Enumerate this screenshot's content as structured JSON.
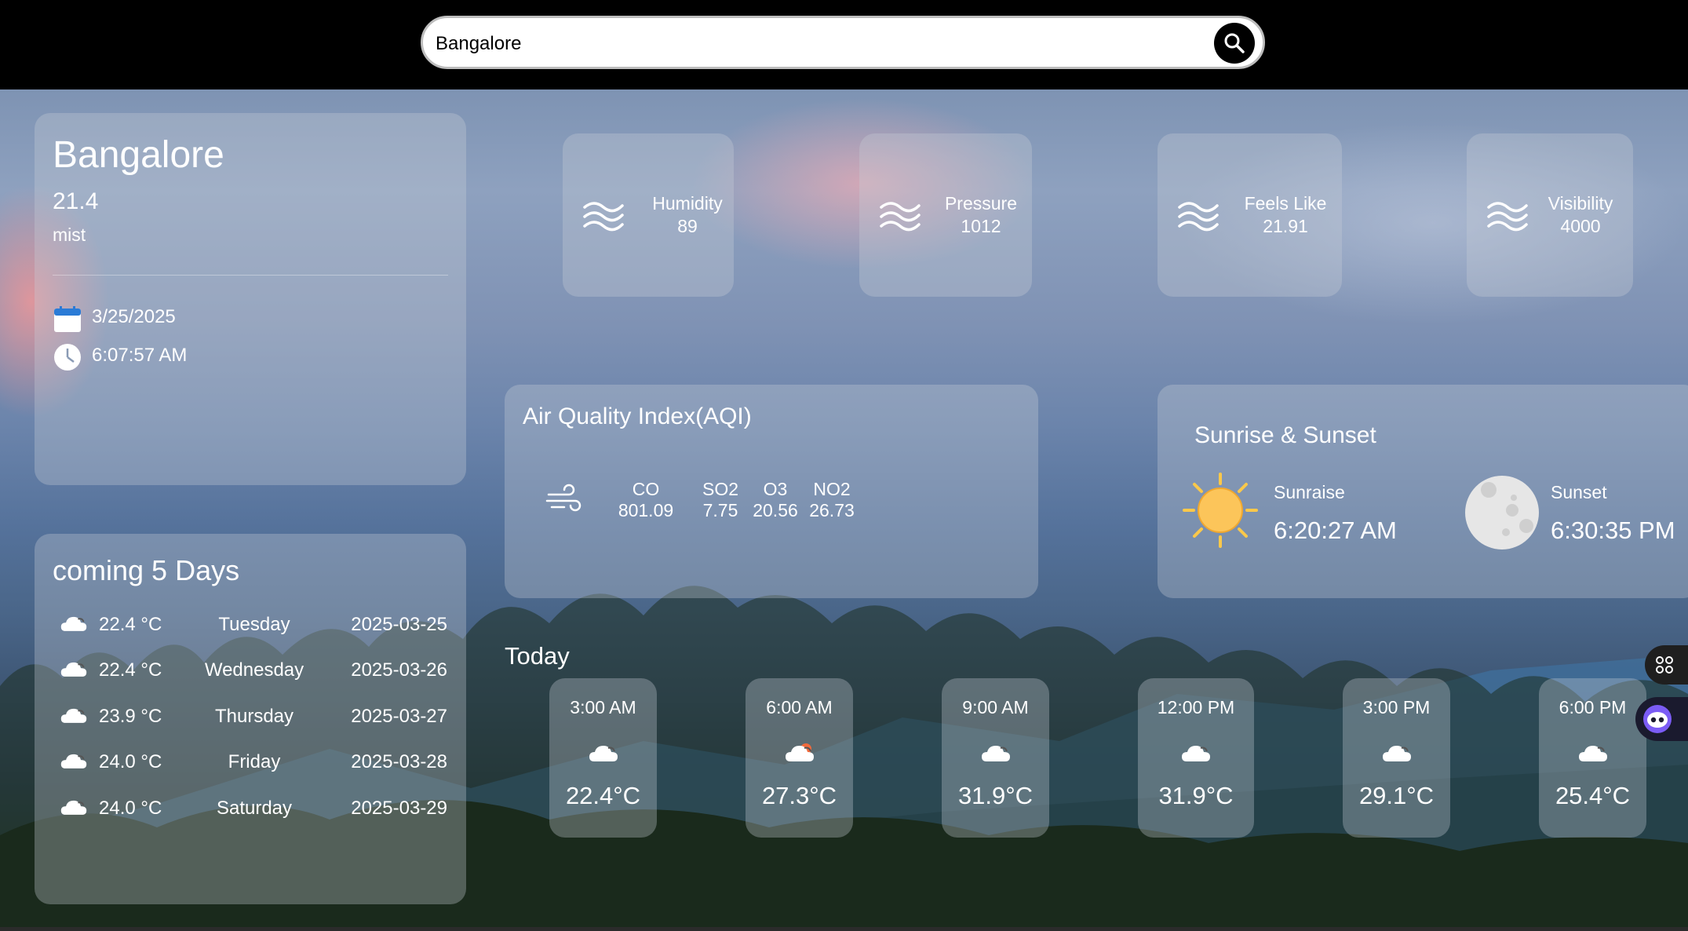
{
  "search": {
    "value": "Bangalore",
    "button_icon": "search-icon"
  },
  "current": {
    "city": "Bangalore",
    "temp": "21.4",
    "description": "mist",
    "date": "3/25/2025",
    "time": "6:07:57 AM"
  },
  "forecast": {
    "title": "coming 5 Days",
    "days": [
      {
        "temp": "22.4 °C",
        "day": "Tuesday",
        "date": "2025-03-25",
        "icon": "cloud-icon"
      },
      {
        "temp": "22.4 °C",
        "day": "Wednesday",
        "date": "2025-03-26",
        "icon": "cloud-icon"
      },
      {
        "temp": "23.9 °C",
        "day": "Thursday",
        "date": "2025-03-27",
        "icon": "cloud-icon"
      },
      {
        "temp": "24.0 °C",
        "day": "Friday",
        "date": "2025-03-28",
        "icon": "cloud-icon"
      },
      {
        "temp": "24.0 °C",
        "day": "Saturday",
        "date": "2025-03-29",
        "icon": "cloud-icon"
      }
    ]
  },
  "metrics": [
    {
      "label": "Humidity",
      "value": "89",
      "icon": "wave-icon"
    },
    {
      "label": "Pressure",
      "value": "1012",
      "icon": "wave-icon"
    },
    {
      "label": "Feels Like",
      "value": "21.91",
      "icon": "wave-icon"
    },
    {
      "label": "Visibility",
      "value": "4000",
      "icon": "wave-icon"
    }
  ],
  "aqi": {
    "title": "Air Quality Index(AQI)",
    "items": [
      {
        "label": "CO",
        "value": "801.09"
      },
      {
        "label": "SO2",
        "value": "7.75"
      },
      {
        "label": "O3",
        "value": "20.56"
      },
      {
        "label": "NO2",
        "value": "26.73"
      }
    ]
  },
  "sun": {
    "title": "Sunrise & Sunset",
    "sunrise_label": "Sunraise",
    "sunrise": "6:20:27 AM",
    "sunset_label": "Sunset",
    "sunset": "6:30:35 PM"
  },
  "today": {
    "title": "Today",
    "hours": [
      {
        "time": "3:00 AM",
        "temp": "22.4°C",
        "icon": "cloud-icon"
      },
      {
        "time": "6:00 AM",
        "temp": "27.3°C",
        "icon": "cloud-sun-icon"
      },
      {
        "time": "9:00 AM",
        "temp": "31.9°C",
        "icon": "cloud-icon"
      },
      {
        "time": "12:00 PM",
        "temp": "31.9°C",
        "icon": "cloud-icon"
      },
      {
        "time": "3:00 PM",
        "temp": "29.1°C",
        "icon": "cloud-icon"
      },
      {
        "time": "6:00 PM",
        "temp": "25.4°C",
        "icon": "cloud-icon"
      }
    ]
  },
  "colors": {
    "topbar": "#000000",
    "card": "rgba(200,205,215,0.33)",
    "sun": "#fbc84a",
    "moon": "#e6e6e6"
  }
}
